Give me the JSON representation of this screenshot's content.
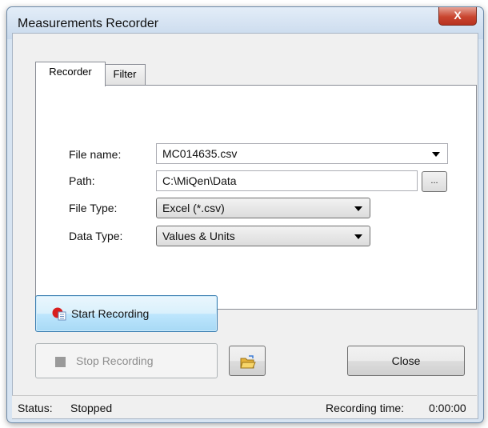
{
  "window": {
    "title": "Measurements Recorder",
    "close_glyph": "X"
  },
  "tabs": [
    {
      "label": "Recorder",
      "active": true
    },
    {
      "label": "Filter",
      "active": false
    }
  ],
  "form": {
    "file_name": {
      "label": "File name:",
      "value": "MC014635.csv"
    },
    "path": {
      "label": "Path:",
      "value": "C:\\MiQen\\Data",
      "browse_label": "..."
    },
    "file_type": {
      "label": "File Type:",
      "value": "Excel (*.csv)"
    },
    "data_type": {
      "label": "Data Type:",
      "value": "Values & Units"
    }
  },
  "buttons": {
    "start": "Start Recording",
    "stop": "Stop Recording",
    "close": "Close"
  },
  "status": {
    "label": "Status:",
    "value": "Stopped",
    "time_label": "Recording time:",
    "time_value": "0:00:00"
  },
  "icons": {
    "start": "record-icon",
    "stop": "stop-icon",
    "open": "folder-open-icon"
  },
  "colors": {
    "titlebar": "#c8d9ec",
    "close_button": "#c9452f",
    "primary_button": "#a7d9f5",
    "record_red": "#d81e1e"
  }
}
